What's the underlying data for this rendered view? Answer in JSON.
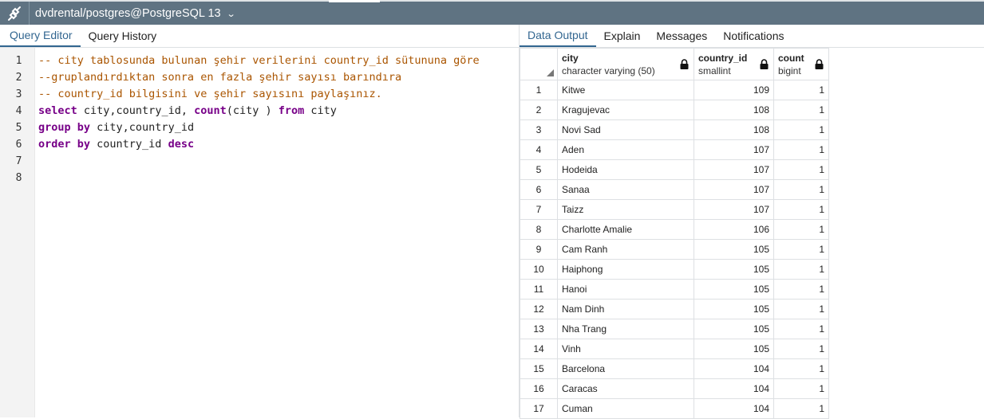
{
  "connection": {
    "title": "dvdrental/postgres@PostgreSQL 13",
    "icon": "connection-icon"
  },
  "left_tabs": [
    {
      "label": "Query Editor",
      "active": true
    },
    {
      "label": "Query History",
      "active": false
    }
  ],
  "right_tabs": [
    {
      "label": "Data Output",
      "active": true
    },
    {
      "label": "Explain",
      "active": false
    },
    {
      "label": "Messages",
      "active": false
    },
    {
      "label": "Notifications",
      "active": false
    }
  ],
  "editor": {
    "line_numbers": [
      "1",
      "2",
      "3",
      "4",
      "5",
      "6",
      "7",
      "8"
    ],
    "lines": [
      [
        {
          "t": "-- city tablosunda bulunan şehir verilerini country_id sütununa göre",
          "c": "cm"
        }
      ],
      [
        {
          "t": "--gruplandırdıktan sonra en fazla şehir sayısı barındıra",
          "c": "cm"
        }
      ],
      [
        {
          "t": "-- country_id bilgisini ve şehir sayısını paylaşınız.",
          "c": "cm"
        }
      ],
      [
        {
          "t": "select",
          "c": "kw"
        },
        {
          "t": " city,country_id, ",
          "c": ""
        },
        {
          "t": "count",
          "c": "kw"
        },
        {
          "t": "(city ) ",
          "c": ""
        },
        {
          "t": "from",
          "c": "kw"
        },
        {
          "t": " city",
          "c": ""
        }
      ],
      [
        {
          "t": "group by",
          "c": "kw"
        },
        {
          "t": " city,country_id",
          "c": ""
        }
      ],
      [
        {
          "t": "order by",
          "c": "kw"
        },
        {
          "t": " country_id ",
          "c": ""
        },
        {
          "t": "desc",
          "c": "kw"
        }
      ],
      [],
      []
    ]
  },
  "grid": {
    "columns": [
      {
        "name": "city",
        "type": "character varying (50)"
      },
      {
        "name": "country_id",
        "type": "smallint"
      },
      {
        "name": "count",
        "type": "bigint"
      }
    ],
    "rows": [
      [
        "1",
        "Kitwe",
        "109",
        "1"
      ],
      [
        "2",
        "Kragujevac",
        "108",
        "1"
      ],
      [
        "3",
        "Novi Sad",
        "108",
        "1"
      ],
      [
        "4",
        "Aden",
        "107",
        "1"
      ],
      [
        "5",
        "Hodeida",
        "107",
        "1"
      ],
      [
        "6",
        "Sanaa",
        "107",
        "1"
      ],
      [
        "7",
        "Taizz",
        "107",
        "1"
      ],
      [
        "8",
        "Charlotte Amalie",
        "106",
        "1"
      ],
      [
        "9",
        "Cam Ranh",
        "105",
        "1"
      ],
      [
        "10",
        "Haiphong",
        "105",
        "1"
      ],
      [
        "11",
        "Hanoi",
        "105",
        "1"
      ],
      [
        "12",
        "Nam Dinh",
        "105",
        "1"
      ],
      [
        "13",
        "Nha Trang",
        "105",
        "1"
      ],
      [
        "14",
        "Vinh",
        "105",
        "1"
      ],
      [
        "15",
        "Barcelona",
        "104",
        "1"
      ],
      [
        "16",
        "Caracas",
        "104",
        "1"
      ],
      [
        "17",
        "Cuman",
        "104",
        "1"
      ]
    ]
  }
}
